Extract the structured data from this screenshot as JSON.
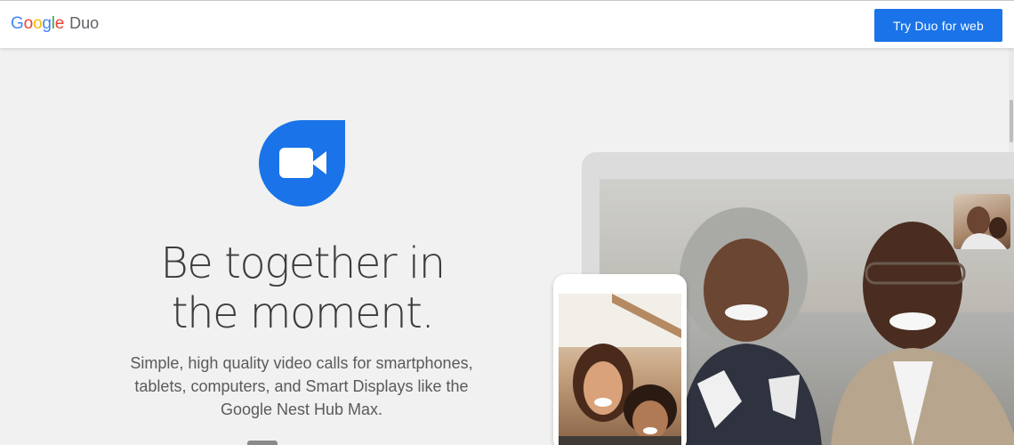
{
  "header": {
    "brand": "Google",
    "product": "Duo",
    "cta_label": "Try Duo for web"
  },
  "hero": {
    "headline_line1": "Be together in",
    "headline_line2": "the moment.",
    "subtext": "Simple, high quality video calls for smartphones, tablets, computers, and Smart Displays like the Google Nest Hub Max."
  },
  "colors": {
    "accent": "#1a73e8",
    "google_blue": "#4285f4",
    "google_red": "#ea4335",
    "google_yellow": "#fbbc05",
    "google_green": "#34a853",
    "duo_icon_blue": "#1a73e8"
  },
  "icons": {
    "app_icon": "duo-video-camera-icon"
  }
}
